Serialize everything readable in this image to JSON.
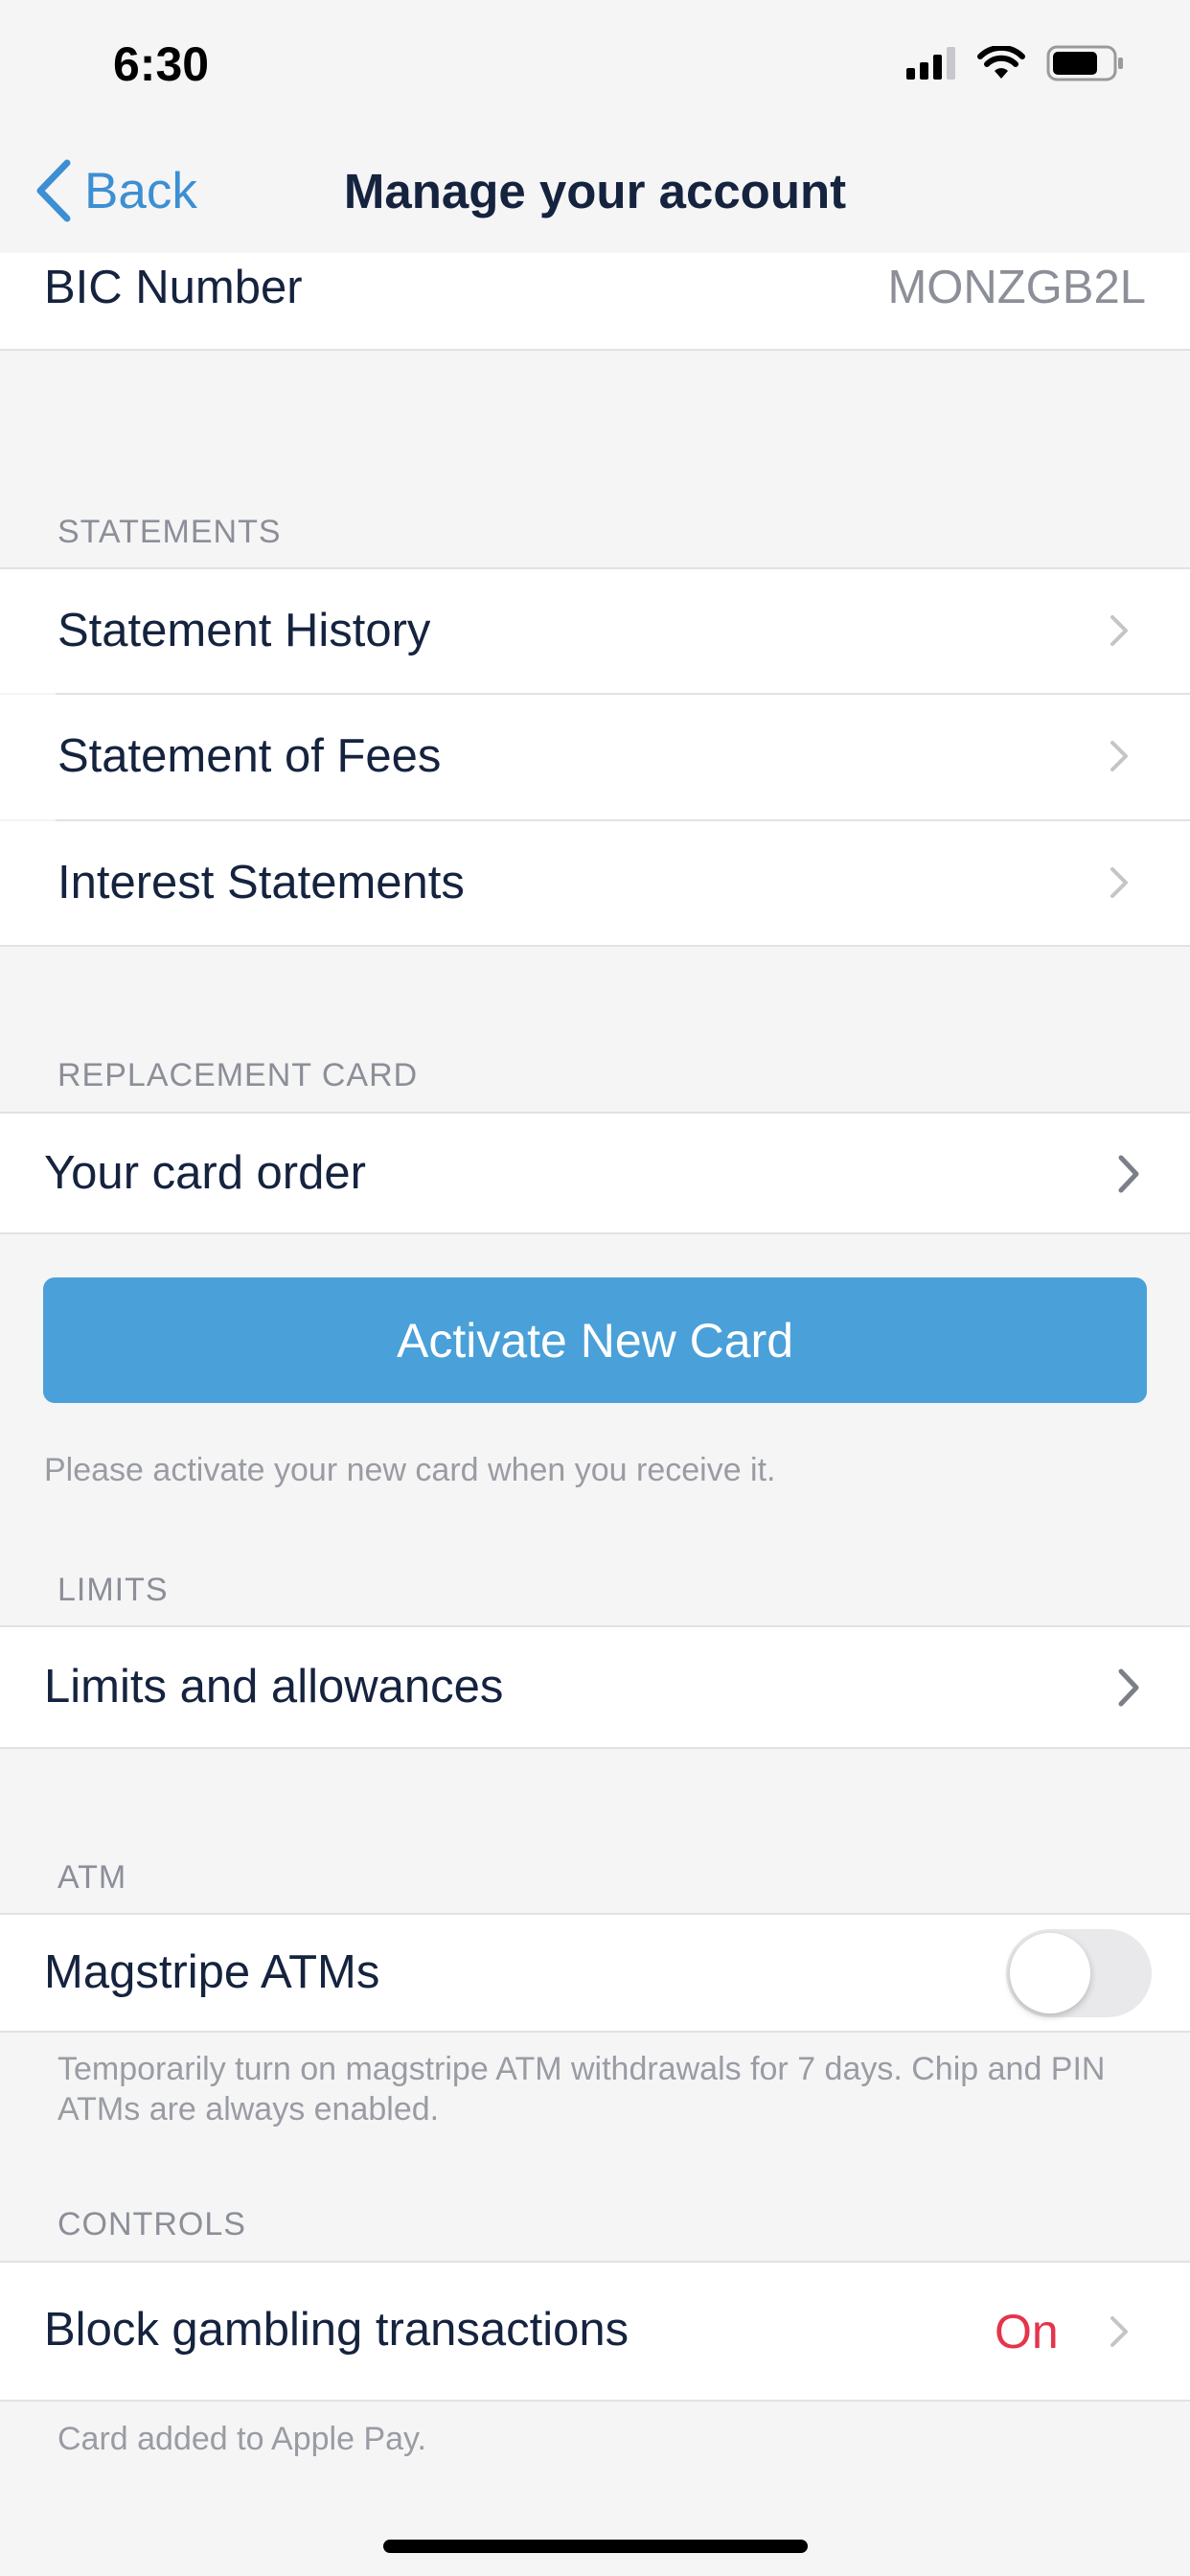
{
  "status_bar": {
    "time": "6:30"
  },
  "nav": {
    "back_label": "Back",
    "title": "Manage your account"
  },
  "bic": {
    "label": "BIC Number",
    "value": "MONZGB2L"
  },
  "statements": {
    "header": "STATEMENTS",
    "items": [
      {
        "label": "Statement History"
      },
      {
        "label": "Statement of Fees"
      },
      {
        "label": "Interest Statements"
      }
    ]
  },
  "replacement_card": {
    "header": "REPLACEMENT CARD",
    "card_order_label": "Your card order",
    "activate_button": "Activate New Card",
    "footer": "Please activate your new card when you receive it."
  },
  "limits": {
    "header": "LIMITS",
    "item_label": "Limits and allowances"
  },
  "atm": {
    "header": "ATM",
    "magstripe_label": "Magstripe ATMs",
    "magstripe_enabled": false,
    "footer": "Temporarily turn on magstripe ATM withdrawals for 7 days. Chip and PIN ATMs are always enabled."
  },
  "controls": {
    "header": "CONTROLS",
    "gambling_label": "Block gambling transactions",
    "gambling_value": "On",
    "footer": "Card added to Apple Pay."
  },
  "colors": {
    "accent": "#3c8fd2",
    "button": "#4aa0d8",
    "on_value": "#e4354b",
    "background": "#f5f5f6"
  }
}
